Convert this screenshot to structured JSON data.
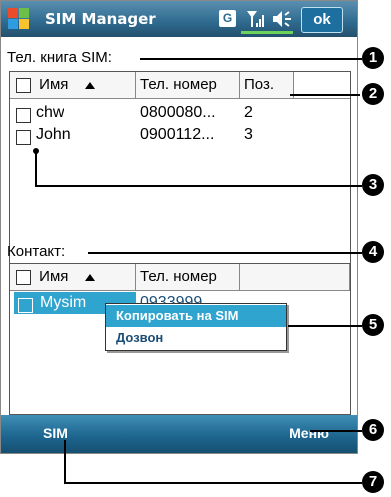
{
  "titlebar": {
    "app_title": "SIM Manager",
    "status_g": "G",
    "ok_label": "ok"
  },
  "sim_section": {
    "label": "Тел. книга SIM:",
    "columns": [
      "Имя",
      "Тел. номер",
      "Поз."
    ],
    "rows": [
      {
        "name": "chw",
        "phone": "0800080...",
        "pos": "2"
      },
      {
        "name": "John",
        "phone": "0900112...",
        "pos": "3"
      }
    ]
  },
  "contact_section": {
    "label": "Контакт:",
    "columns": [
      "Имя",
      "Тел. номер"
    ],
    "rows": [
      {
        "name": "Mysim",
        "phone": "0933999"
      }
    ]
  },
  "context_menu": {
    "items": [
      "Копировать на SIM",
      "Дозвон"
    ]
  },
  "menubar": {
    "left_label": "SIM",
    "right_label": "Меню"
  },
  "callouts": [
    "1",
    "2",
    "3",
    "4",
    "5",
    "6",
    "7"
  ],
  "icons": {
    "start": "windows-flag-icon",
    "signal": "signal-strength-icon",
    "speaker": "speaker-icon"
  },
  "colors": {
    "title_bar": "#2e6a8e",
    "selection": "#2fa4cf",
    "menu_bar": "#1e6690"
  }
}
